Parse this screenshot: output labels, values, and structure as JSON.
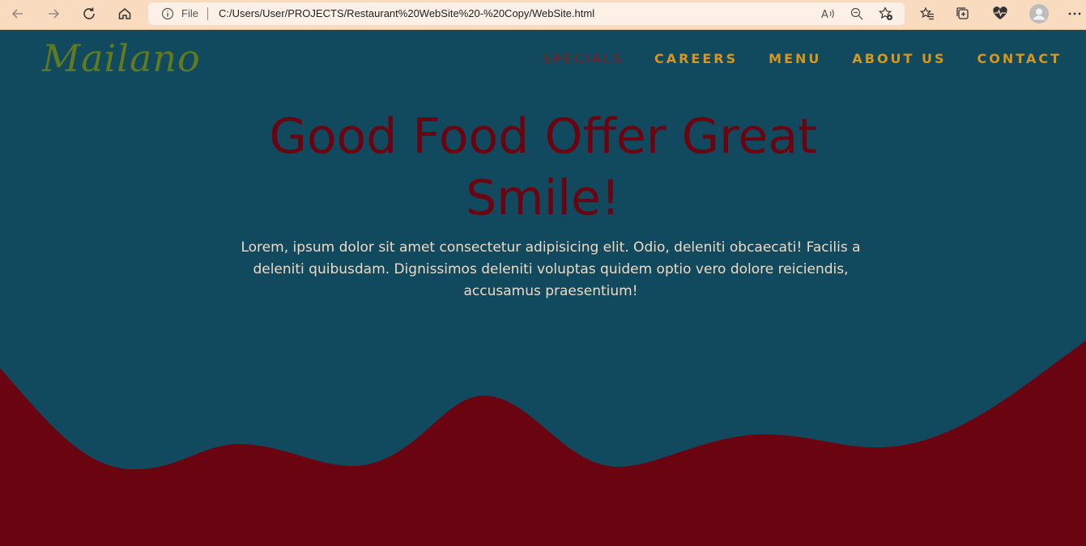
{
  "browser": {
    "scheme_label": "File",
    "url": "C:/Users/User/PROJECTS/Restaurant%20WebSite%20-%20Copy/WebSite.html",
    "chrome_color": "#f9dcc0",
    "icons": [
      "back-icon",
      "forward-icon",
      "refresh-icon",
      "home-icon",
      "info-icon",
      "read-aloud-icon",
      "zoom-icon",
      "add-favorite-icon",
      "favorites-icon",
      "collections-icon",
      "health-icon",
      "profile-icon",
      "more-icon"
    ]
  },
  "site": {
    "logo": "Mailano",
    "nav": [
      {
        "label": "SPECIALS",
        "active": true
      },
      {
        "label": "CAREERS",
        "active": false
      },
      {
        "label": "MENU",
        "active": false
      },
      {
        "label": "ABOUT US",
        "active": false
      },
      {
        "label": "CONTACT",
        "active": false
      }
    ],
    "hero": {
      "title_line1": "Good Food Offer Great",
      "title_line2": "Smile!",
      "text": "Lorem, ipsum dolor sit amet consectetur adipisicing elit. Odio, deleniti obcaecati! Facilis a deleniti quibusdam. Dignissimos deleniti voluptas quidem optio vero dolore reiciendis, accusamus praesentium!"
    },
    "colors": {
      "background": "#114a5f",
      "wave": "#6b0411",
      "title": "#6b0411",
      "nav": "#d8961b",
      "nav_active": "#8d1a1a",
      "logo": "#5f7a1f",
      "body_text": "#f0d9c2"
    }
  }
}
